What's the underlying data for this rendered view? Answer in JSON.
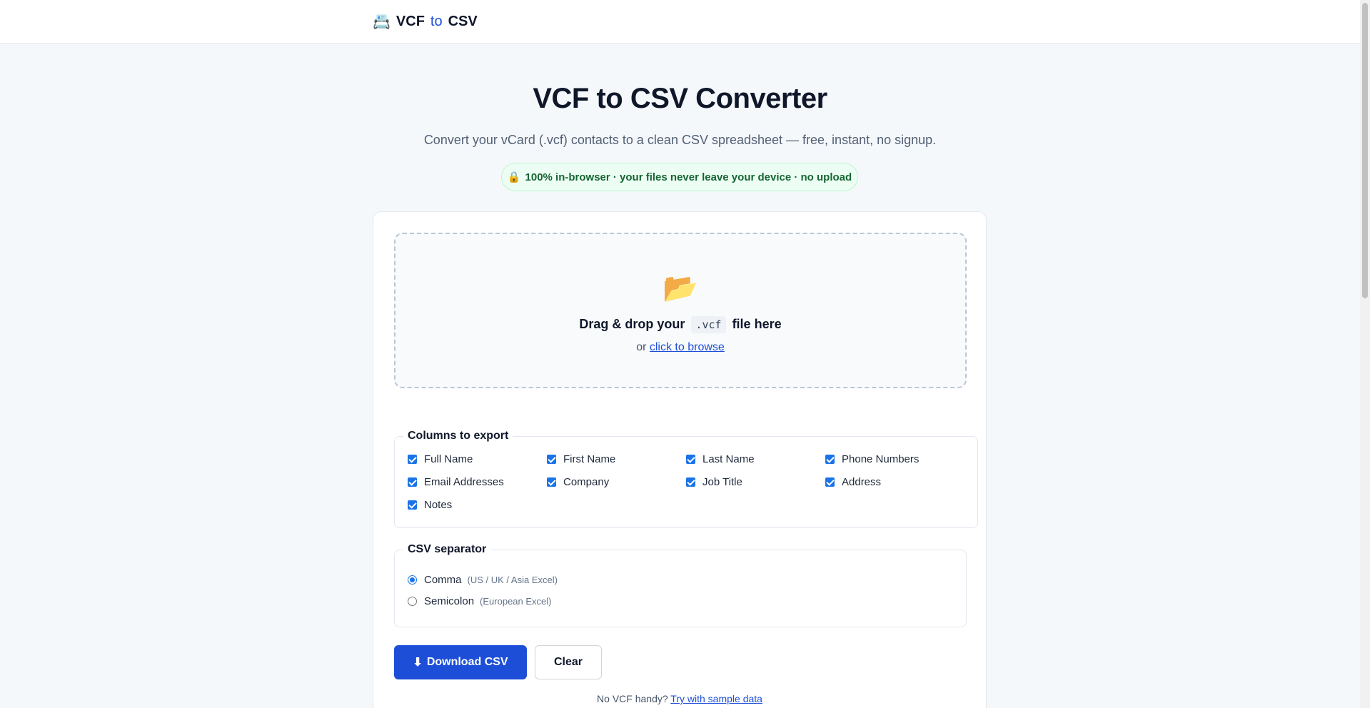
{
  "header": {
    "logo_icon": "📇",
    "logo_left": "VCF",
    "logo_mid": "to",
    "logo_right": "CSV"
  },
  "hero": {
    "title": "VCF to CSV Converter",
    "subtitle": "Convert your vCard (.vcf) contacts to a clean CSV spreadsheet — free, instant, no signup.",
    "badge_icon": "🔒",
    "badge_text": "100% in-browser · your files never leave your device · no upload"
  },
  "dropzone": {
    "icon": "📂",
    "title_before": "Drag & drop your",
    "title_code": ".vcf",
    "title_after": "file here",
    "or_text": "or",
    "browse_link": "click to browse"
  },
  "columns": {
    "legend": "Columns to export",
    "items": [
      {
        "label": "Full Name",
        "checked": true
      },
      {
        "label": "First Name",
        "checked": true
      },
      {
        "label": "Last Name",
        "checked": true
      },
      {
        "label": "Phone Numbers",
        "checked": true
      },
      {
        "label": "Email Addresses",
        "checked": true
      },
      {
        "label": "Company",
        "checked": true
      },
      {
        "label": "Job Title",
        "checked": true
      },
      {
        "label": "Address",
        "checked": true
      },
      {
        "label": "Notes",
        "checked": true
      }
    ]
  },
  "separator": {
    "legend": "CSV separator",
    "options": [
      {
        "label": "Comma",
        "hint": "(US / UK / Asia Excel)",
        "selected": true
      },
      {
        "label": "Semicolon",
        "hint": "(European Excel)",
        "selected": false
      }
    ]
  },
  "actions": {
    "download_icon": "⬇",
    "download_label": "Download CSV",
    "clear_label": "Clear",
    "sample_prefix": "No VCF handy?",
    "sample_link": "Try with sample data"
  },
  "colors": {
    "accent": "#1d4ed8",
    "badge_bg": "#ecfdf3",
    "badge_text": "#166534"
  }
}
